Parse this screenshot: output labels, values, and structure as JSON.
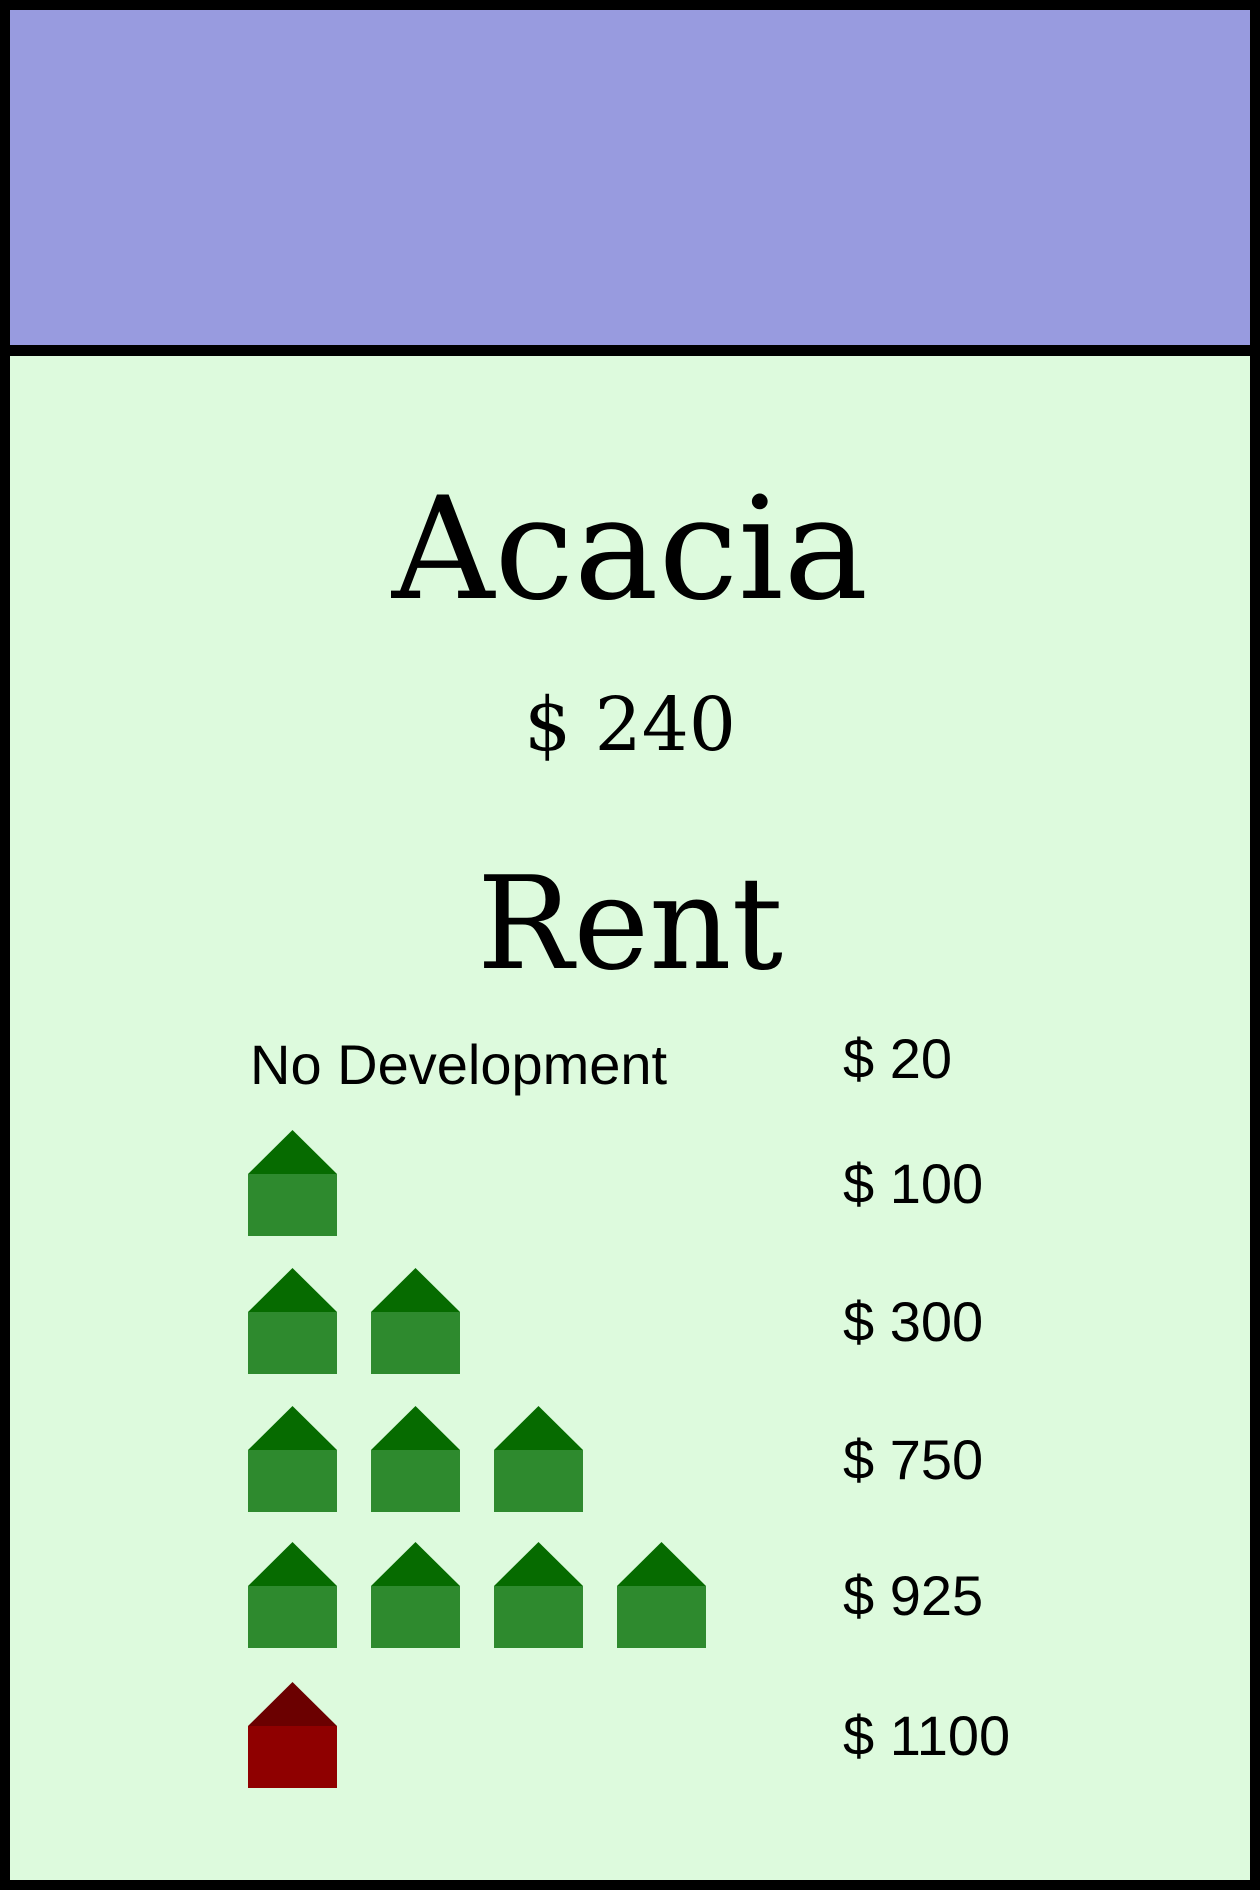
{
  "card": {
    "title": "Acacia",
    "price": "$ 240",
    "band_color": "#989bdf",
    "background_color": "#ddfadd"
  },
  "rent": {
    "heading": "Rent",
    "rows": [
      {
        "label": "No Development",
        "houses": 0,
        "hotel": false,
        "value": "$ 20"
      },
      {
        "label": "",
        "houses": 1,
        "hotel": false,
        "value": "$ 100"
      },
      {
        "label": "",
        "houses": 2,
        "hotel": false,
        "value": "$ 300"
      },
      {
        "label": "",
        "houses": 3,
        "hotel": false,
        "value": "$ 750"
      },
      {
        "label": "",
        "houses": 4,
        "hotel": false,
        "value": "$ 925"
      },
      {
        "label": "",
        "houses": 0,
        "hotel": true,
        "value": "$ 1100"
      }
    ]
  },
  "icons": {
    "house": {
      "name": "house-icon",
      "roof_color": "#066b00",
      "body_color": "#2e8a2e"
    },
    "hotel": {
      "name": "hotel-icon",
      "roof_color": "#6b0000",
      "body_color": "#8f0000"
    }
  }
}
